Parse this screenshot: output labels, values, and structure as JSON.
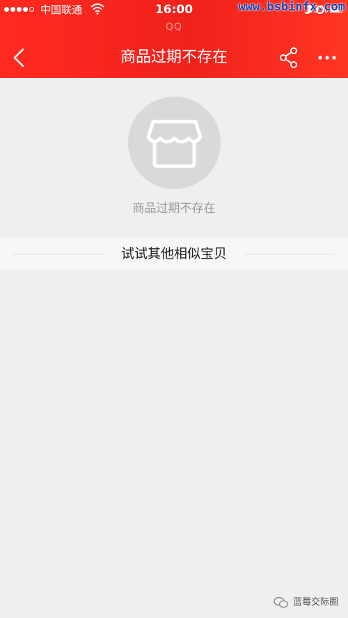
{
  "status_bar": {
    "carrier": "中国联通",
    "time": "16:00",
    "battery": "89%",
    "battery_level": 0.89
  },
  "app_label": "QQ",
  "navbar": {
    "title": "商品过期不存在",
    "back_icon": "chevron-left-icon",
    "share_icon": "share-icon",
    "more_icon": "more-icon"
  },
  "watermark": "www.bsbinfx.com",
  "empty_state": {
    "icon": "store-icon",
    "message": "商品过期不存在"
  },
  "similar": {
    "title": "试试其他相似宝贝"
  },
  "footer_watermark": "蓝莓交际圈",
  "colors": {
    "brand_red": "#f0221c",
    "background": "#efefef",
    "muted_text": "#9a9a9a"
  }
}
